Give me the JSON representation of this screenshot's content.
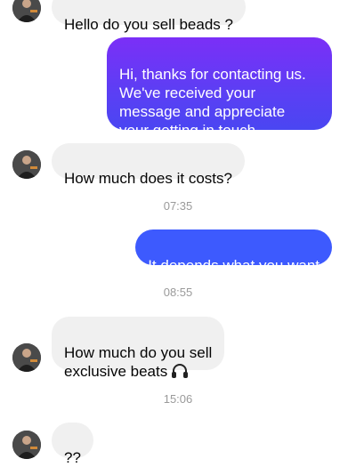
{
  "colors": {
    "incoming_bg": "#f0f0f0",
    "outgoing_gradient_top": "#7b2ff7",
    "outgoing_gradient_bottom": "#4a46f2",
    "outgoing_solid": "#3d5afe",
    "timestamp": "#9a9a9a"
  },
  "messages": [
    {
      "id": "m1",
      "direction": "incoming",
      "text": "Hello do you sell beads ?"
    },
    {
      "id": "m2",
      "direction": "outgoing",
      "text": "Hi, thanks for contacting us.\nWe've received your\nmessage and appreciate\nyour getting in touch."
    },
    {
      "id": "m3",
      "direction": "incoming",
      "text": "How much does it costs?"
    },
    {
      "id": "t1",
      "type": "timestamp",
      "text": "07:35"
    },
    {
      "id": "m4",
      "direction": "outgoing",
      "text": "It depends what you want"
    },
    {
      "id": "t2",
      "type": "timestamp",
      "text": "08:55"
    },
    {
      "id": "m5",
      "direction": "incoming",
      "text": "How much do you sell\nexclusive beats",
      "icon": "headphones-icon"
    },
    {
      "id": "t3",
      "type": "timestamp",
      "text": "15:06"
    },
    {
      "id": "m6",
      "direction": "incoming",
      "text": "??"
    }
  ]
}
